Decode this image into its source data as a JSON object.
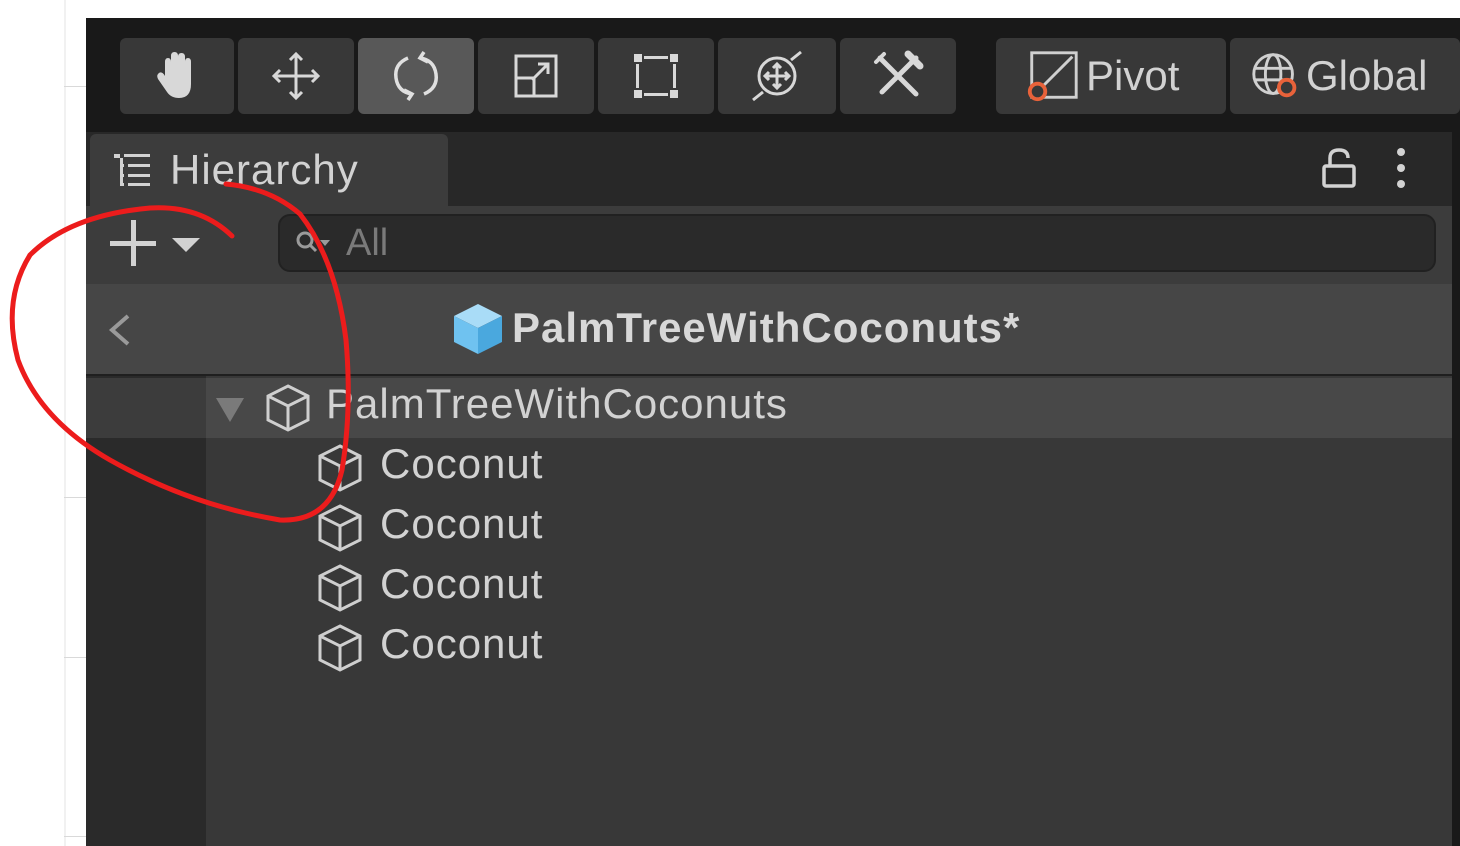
{
  "toolbar": {
    "tools": [
      {
        "icon": "hand-icon",
        "active": false
      },
      {
        "icon": "move-icon",
        "active": false
      },
      {
        "icon": "rotate-icon",
        "active": true
      },
      {
        "icon": "scale-icon",
        "active": false
      },
      {
        "icon": "rect-tool-icon",
        "active": false
      },
      {
        "icon": "transform-icon",
        "active": false
      },
      {
        "icon": "custom-tool-icon",
        "active": false
      }
    ],
    "pivot_label": "Pivot",
    "global_label": "Global"
  },
  "hierarchy": {
    "tab_title": "Hierarchy",
    "search_placeholder": "All",
    "prefab_title": "PalmTreeWithCoconuts*",
    "root": {
      "label": "PalmTreeWithCoconuts",
      "expanded": true,
      "children": [
        {
          "label": "Coconut"
        },
        {
          "label": "Coconut"
        },
        {
          "label": "Coconut"
        },
        {
          "label": "Coconut"
        }
      ]
    }
  },
  "colors": {
    "panel_bg": "#383838",
    "header_bg": "#464646",
    "text": "#d2d2d2",
    "prefab_blue": "#6fc2f0",
    "handle_orange": "#e8623a",
    "annotation_red": "#ec1c1c"
  }
}
